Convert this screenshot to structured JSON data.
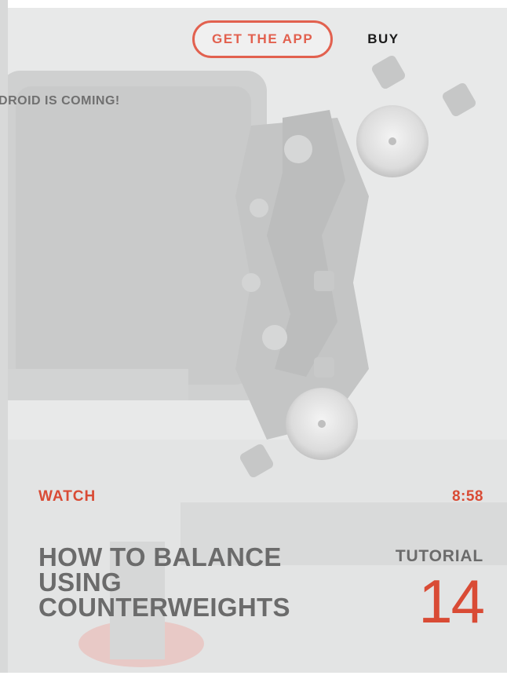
{
  "nav": {
    "get_app_label": "GET THE APP",
    "buy_label": "BUY"
  },
  "announcement": "NDROID IS COMING!",
  "video": {
    "watch_label": "WATCH",
    "duration": "8:58",
    "title": "HOW TO BALANCE USING COUNTERWEIGHTS",
    "tutorial_label": "TUTORIAL",
    "tutorial_number": "14"
  },
  "colors": {
    "accent": "#e2614f",
    "accent_text": "#d94b35",
    "muted_text": "#6b6b6b"
  }
}
